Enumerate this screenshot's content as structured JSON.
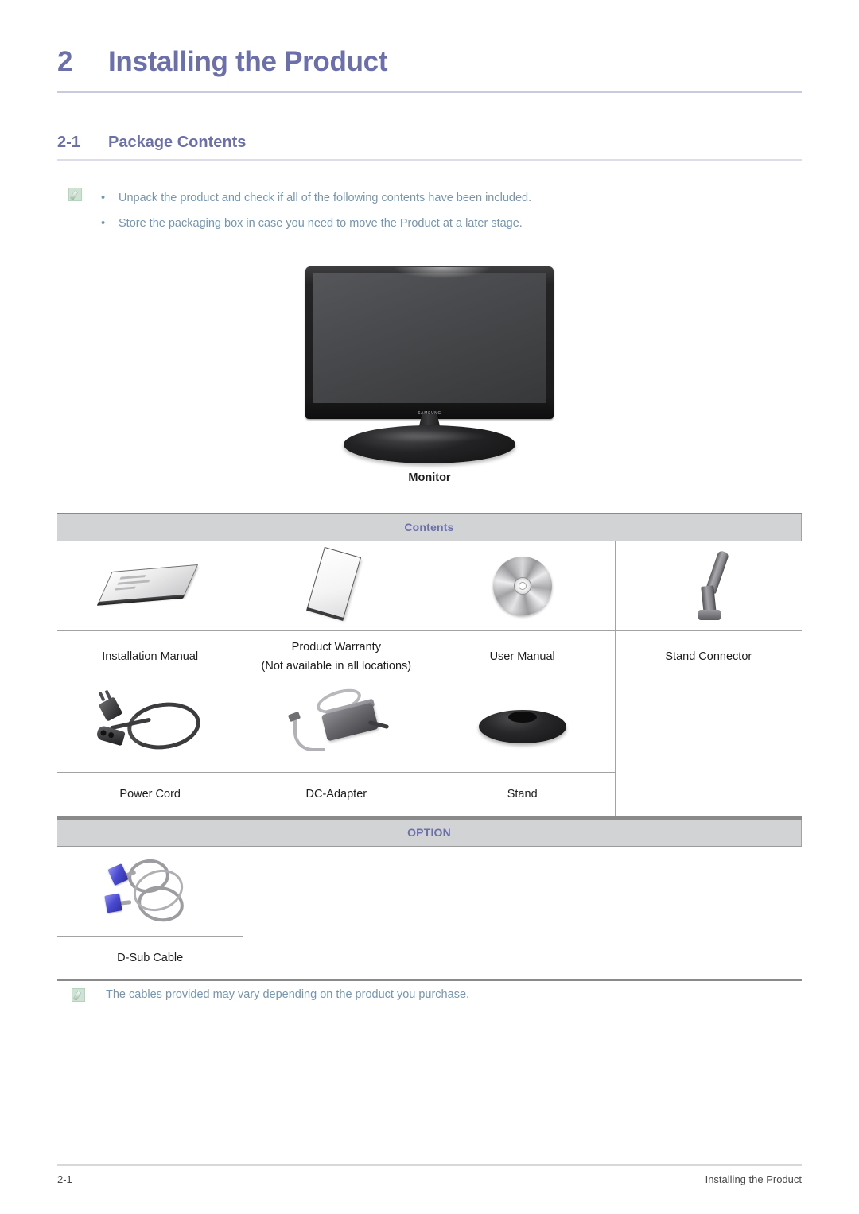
{
  "chapter": {
    "number": "2",
    "title": "Installing the Product"
  },
  "section": {
    "number": "2-1",
    "title": "Package Contents"
  },
  "intro_note": {
    "icon": "note-icon",
    "bullet_char": "•",
    "bullets": [
      "Unpack the product and check if all of the following contents have been included.",
      "Store the packaging box in case you need to move the Product at a later stage."
    ]
  },
  "figure": {
    "caption": "Monitor",
    "brand_logo": "SAMSUNG"
  },
  "contents_table": {
    "header": "Contents",
    "rows": [
      {
        "cells": [
          {
            "icon": "installation-manual-icon",
            "label_line1": "Installation Manual",
            "label_line2": ""
          },
          {
            "icon": "product-warranty-icon",
            "label_line1": "Product Warranty",
            "label_line2": "(Not available in all locations)"
          },
          {
            "icon": "user-manual-cd-icon",
            "label_line1": "User Manual",
            "label_line2": ""
          },
          {
            "icon": "stand-connector-icon",
            "label_line1": "Stand Connector",
            "label_line2": ""
          }
        ]
      },
      {
        "cells": [
          {
            "icon": "power-cord-icon",
            "label_line1": "Power Cord",
            "label_line2": ""
          },
          {
            "icon": "dc-adapter-icon",
            "label_line1": "DC-Adapter",
            "label_line2": ""
          },
          {
            "icon": "stand-icon",
            "label_line1": "Stand",
            "label_line2": ""
          },
          {
            "icon": "",
            "label_line1": "",
            "label_line2": ""
          }
        ]
      }
    ]
  },
  "option_table": {
    "header": "OPTION",
    "rows": [
      {
        "cells": [
          {
            "icon": "d-sub-cable-icon",
            "label_line1": "D-Sub Cable",
            "label_line2": ""
          },
          {
            "icon": "",
            "label_line1": "",
            "label_line2": ""
          }
        ]
      }
    ]
  },
  "bottom_note": {
    "icon": "note-icon",
    "text": "The cables provided may vary depending on the product you purchase."
  },
  "page_footer": {
    "left": "2-1",
    "right": "Installing the Product"
  },
  "colors": {
    "heading": "#6b70ab",
    "note_text": "#7595b2",
    "table_header_bg": "#d2d3d5",
    "table_header_text": "#6b70ab",
    "body_text": "#1d1d1d"
  }
}
